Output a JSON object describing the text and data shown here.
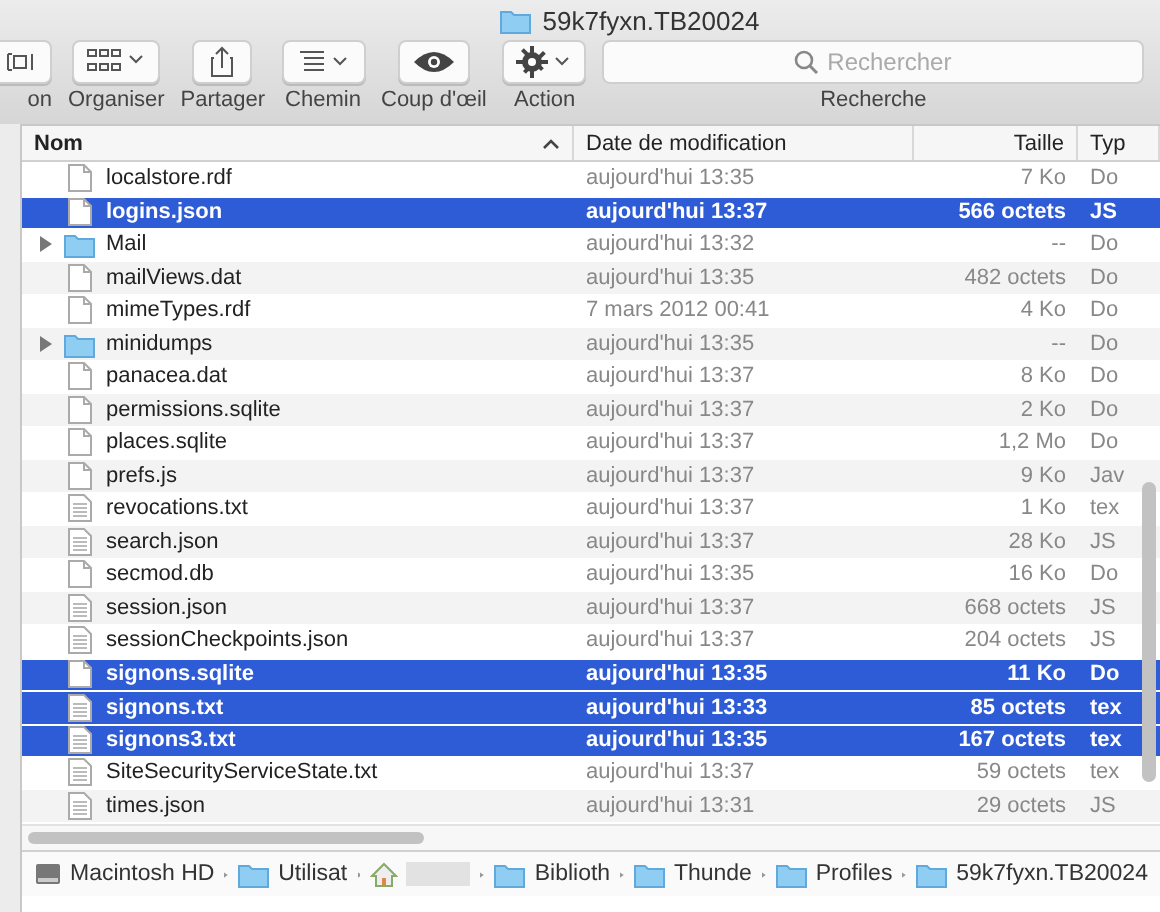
{
  "window": {
    "title": "59k7fyxn.TB20024"
  },
  "toolbar": {
    "items": [
      {
        "kind": "partial",
        "label": "on"
      },
      {
        "kind": "arrange",
        "label": "Organiser"
      },
      {
        "kind": "share",
        "label": "Partager"
      },
      {
        "kind": "path",
        "label": "Chemin"
      },
      {
        "kind": "eye",
        "label": "Coup d'œil"
      },
      {
        "kind": "gear",
        "label": "Action"
      }
    ],
    "search": {
      "placeholder": "Rechercher",
      "label": "Recherche"
    }
  },
  "table": {
    "columns": [
      {
        "label": "Nom",
        "sorted": true
      },
      {
        "label": "Date de modification",
        "sorted": false
      },
      {
        "label": "Taille",
        "sorted": false
      },
      {
        "label": "Typ",
        "sorted": false
      }
    ],
    "rows": [
      {
        "kind": "file",
        "name": "localstore.rdf",
        "date": "aujourd'hui 13:35",
        "size": "7 Ko",
        "type": "Do",
        "selected": false
      },
      {
        "kind": "file",
        "name": "logins.json",
        "date": "aujourd'hui 13:37",
        "size": "566 octets",
        "type": "JS",
        "selected": true
      },
      {
        "kind": "folder",
        "name": "Mail",
        "date": "aujourd'hui 13:32",
        "size": "--",
        "type": "Do",
        "selected": false,
        "expanded": false
      },
      {
        "kind": "file",
        "name": "mailViews.dat",
        "date": "aujourd'hui 13:35",
        "size": "482 octets",
        "type": "Do",
        "selected": false
      },
      {
        "kind": "file",
        "name": "mimeTypes.rdf",
        "date": "7 mars 2012 00:41",
        "size": "4 Ko",
        "type": "Do",
        "selected": false
      },
      {
        "kind": "folder",
        "name": "minidumps",
        "date": "aujourd'hui 13:35",
        "size": "--",
        "type": "Do",
        "selected": false,
        "expanded": false
      },
      {
        "kind": "file",
        "name": "panacea.dat",
        "date": "aujourd'hui 13:37",
        "size": "8 Ko",
        "type": "Do",
        "selected": false
      },
      {
        "kind": "file",
        "name": "permissions.sqlite",
        "date": "aujourd'hui 13:37",
        "size": "2 Ko",
        "type": "Do",
        "selected": false
      },
      {
        "kind": "file",
        "name": "places.sqlite",
        "date": "aujourd'hui 13:37",
        "size": "1,2 Mo",
        "type": "Do",
        "selected": false
      },
      {
        "kind": "file",
        "name": "prefs.js",
        "date": "aujourd'hui 13:37",
        "size": "9 Ko",
        "type": "Jav",
        "selected": false
      },
      {
        "kind": "text",
        "name": "revocations.txt",
        "date": "aujourd'hui 13:37",
        "size": "1 Ko",
        "type": "tex",
        "selected": false
      },
      {
        "kind": "text",
        "name": "search.json",
        "date": "aujourd'hui 13:37",
        "size": "28 Ko",
        "type": "JS",
        "selected": false
      },
      {
        "kind": "file",
        "name": "secmod.db",
        "date": "aujourd'hui 13:35",
        "size": "16 Ko",
        "type": "Do",
        "selected": false
      },
      {
        "kind": "text",
        "name": "session.json",
        "date": "aujourd'hui 13:37",
        "size": "668 octets",
        "type": "JS",
        "selected": false
      },
      {
        "kind": "text",
        "name": "sessionCheckpoints.json",
        "date": "aujourd'hui 13:37",
        "size": "204 octets",
        "type": "JS",
        "selected": false
      },
      {
        "kind": "file",
        "name": "signons.sqlite",
        "date": "aujourd'hui 13:35",
        "size": "11 Ko",
        "type": "Do",
        "selected": true
      },
      {
        "kind": "text",
        "name": "signons.txt",
        "date": "aujourd'hui 13:33",
        "size": "85 octets",
        "type": "tex",
        "selected": true
      },
      {
        "kind": "text",
        "name": "signons3.txt",
        "date": "aujourd'hui 13:35",
        "size": "167 octets",
        "type": "tex",
        "selected": true
      },
      {
        "kind": "text",
        "name": "SiteSecurityServiceState.txt",
        "date": "aujourd'hui 13:37",
        "size": "59 octets",
        "type": "tex",
        "selected": false
      },
      {
        "kind": "text",
        "name": "times.json",
        "date": "aujourd'hui 13:31",
        "size": "29 octets",
        "type": "JS",
        "selected": false
      }
    ]
  },
  "path_bar": [
    {
      "kind": "disk",
      "label": "Macintosh HD"
    },
    {
      "kind": "folder",
      "label": "Utilisat"
    },
    {
      "kind": "home"
    },
    {
      "kind": "folder",
      "label": "Biblioth"
    },
    {
      "kind": "folder",
      "label": "Thunde"
    },
    {
      "kind": "folder",
      "label": "Profiles"
    },
    {
      "kind": "folder",
      "label": "59k7fyxn.TB20024"
    }
  ]
}
